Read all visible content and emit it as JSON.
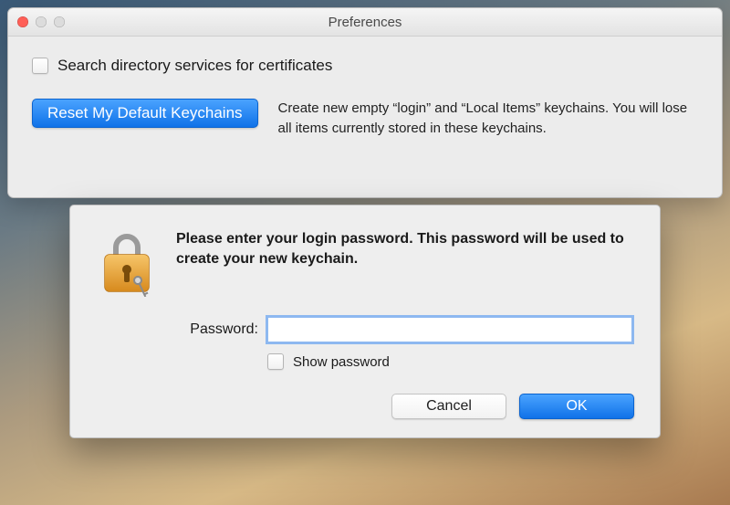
{
  "preferences": {
    "title": "Preferences",
    "search_cert_checkbox": {
      "label": "Search directory services for certificates",
      "checked": false
    },
    "reset_button_label": "Reset My Default Keychains",
    "reset_description": "Create new empty “login” and “Local Items” keychains. You will lose all items currently stored in these keychains."
  },
  "password_sheet": {
    "icon": "lock-icon",
    "prompt": "Please enter your login password. This password will be used to create your new keychain.",
    "password_label": "Password:",
    "password_value": "",
    "show_password_checkbox": {
      "label": "Show password",
      "checked": false
    },
    "cancel_label": "Cancel",
    "ok_label": "OK"
  }
}
